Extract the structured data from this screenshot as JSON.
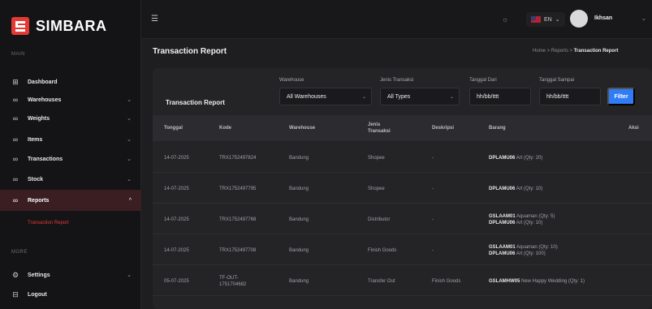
{
  "sidebar": {
    "brand": "SIMBARA",
    "section_main": "MAIN",
    "section_more": "MORE",
    "items": [
      {
        "label": "Dashboard",
        "chevron": ""
      },
      {
        "label": "Warehouses",
        "chevron": "⌄"
      },
      {
        "label": "Weights",
        "chevron": "⌄"
      },
      {
        "label": "Items",
        "chevron": "⌄"
      },
      {
        "label": "Transactions",
        "chevron": "⌄"
      },
      {
        "label": "Stock",
        "chevron": "⌄"
      },
      {
        "label": "Reports",
        "chevron": "^"
      }
    ],
    "sub_item": "Transaction Report",
    "more_items": [
      {
        "label": "Settings",
        "chevron": "⌄"
      },
      {
        "label": "Logout",
        "chevron": ""
      }
    ]
  },
  "topbar": {
    "lang": "EN",
    "username": "Ikhsan"
  },
  "page": {
    "title": "Transaction Report",
    "breadcrumb": [
      "Home",
      "Reports",
      "Transaction Report"
    ]
  },
  "card": {
    "title": "Transaction Report",
    "filters": {
      "warehouse_label": "Warehouse",
      "warehouse_value": "All Warehouses",
      "type_label": "Jenis Transaksi",
      "type_value": "All Types",
      "date_from_label": "Tanggal Dari",
      "date_from_value": "hh/bb/tttt",
      "date_to_label": "Tanggal Sampai",
      "date_to_value": "hh/bb/tttt",
      "filter_button": "Filter"
    },
    "columns": [
      "Tonggal",
      "Kode",
      "Warehouse",
      "Jenis Transaksi",
      "Deskripsi",
      "Barang",
      "Aksi"
    ],
    "rows": [
      {
        "date": "14-07-2025",
        "code": "TRX1752497824",
        "warehouse": "Bandung",
        "type": "Shopee",
        "desc": "-",
        "items": [
          {
            "code": "DPLAMU06",
            "rest": "Art (Qty: 20)"
          }
        ]
      },
      {
        "date": "14-07-2025",
        "code": "TRX1752497795",
        "warehouse": "Bandung",
        "type": "Shopee",
        "desc": "-",
        "items": [
          {
            "code": "DPLAMU06",
            "rest": "Art (Qty: 10)"
          }
        ]
      },
      {
        "date": "14-07-2025",
        "code": "TRX1752497768",
        "warehouse": "Bandung",
        "type": "Distributor",
        "desc": "-",
        "items": [
          {
            "code": "GSLAAM01",
            "rest": "Aquaman (Qty: 5)"
          },
          {
            "code": "DPLAMU06",
            "rest": "Art (Qty: 10)"
          }
        ]
      },
      {
        "date": "14-07-2025",
        "code": "TRX1752497708",
        "warehouse": "Bandung",
        "type": "Finish Goods",
        "desc": "-",
        "items": [
          {
            "code": "GSLAAM01",
            "rest": "Aquaman (Qty: 10)"
          },
          {
            "code": "DPLAMU06",
            "rest": "Art (Qty: 100)"
          }
        ]
      },
      {
        "date": "05-07-2025",
        "code": "TF-OUT-1751704682",
        "warehouse": "Bandung",
        "type": "Transfer Out",
        "desc": "Finish Goods",
        "items": [
          {
            "code": "GSLAMHW05",
            "rest": "New Happy Wedding (Qty: 1)"
          }
        ]
      }
    ]
  }
}
